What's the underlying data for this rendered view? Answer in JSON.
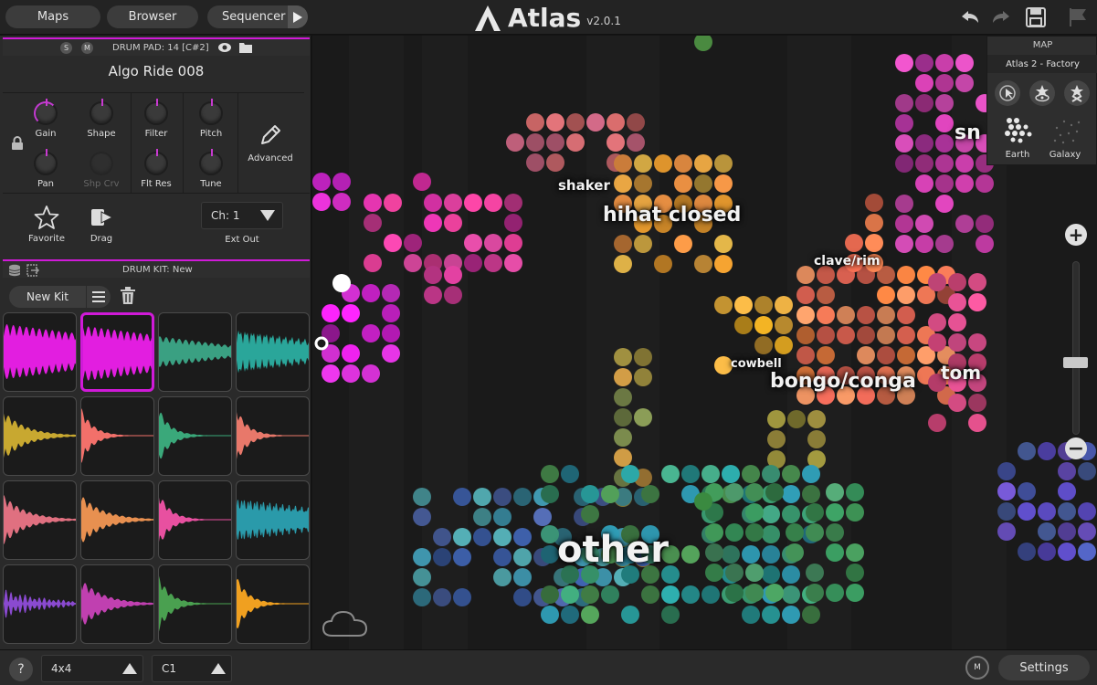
{
  "topbar": {
    "maps_label": "Maps",
    "browser_label": "Browser",
    "sequencer_label": "Sequencer",
    "app_name": "Atlas",
    "version": "v2.0.1"
  },
  "pad": {
    "solo": "S",
    "mute": "M",
    "title": "DRUM PAD: 14 [C#2]",
    "sample_name": "Algo Ride 008",
    "knobs": [
      {
        "label": "Gain",
        "value": 0.35
      },
      {
        "label": "Shape",
        "value": 0.5
      },
      {
        "label": "Filter",
        "value": 0.5
      },
      {
        "label": "Pitch",
        "value": 0.5
      },
      {
        "label": "Pan",
        "value": 0.5
      },
      {
        "label": "Shp Crv",
        "value": 0.5
      },
      {
        "label": "Flt Res",
        "value": 0.5
      },
      {
        "label": "Tune",
        "value": 0.5
      }
    ],
    "advanced_label": "Advanced",
    "favorite_label": "Favorite",
    "drag_label": "Drag",
    "channel": "Ch: 1",
    "ext_out_label": "Ext Out",
    "accent": "#d01ad8"
  },
  "kit": {
    "title": "DRUM KIT: New",
    "name_button": "New Kit",
    "pads": [
      {
        "color": "#e21ee0",
        "type": "sustain"
      },
      {
        "color": "#e21ee0",
        "type": "sustain",
        "selected": true
      },
      {
        "color": "#3aa082",
        "type": "fade"
      },
      {
        "color": "#2aa69a",
        "type": "comb"
      },
      {
        "color": "#c8a830",
        "type": "decay"
      },
      {
        "color": "#f2706a",
        "type": "hit"
      },
      {
        "color": "#3aa87a",
        "type": "hit"
      },
      {
        "color": "#e8786a",
        "type": "hit"
      },
      {
        "color": "#e07080",
        "type": "decay"
      },
      {
        "color": "#e89050",
        "type": "decay"
      },
      {
        "color": "#e850a0",
        "type": "hit"
      },
      {
        "color": "#2a9aaa",
        "type": "comb"
      },
      {
        "color": "#8a4ad0",
        "type": "wave"
      },
      {
        "color": "#c040b0",
        "type": "decay"
      },
      {
        "color": "#4aa050",
        "type": "hit"
      },
      {
        "color": "#f0a020",
        "type": "hit"
      }
    ]
  },
  "map": {
    "clusters": [
      {
        "label": "shaker",
        "size": 15
      },
      {
        "label": "hihat closed",
        "size": 22
      },
      {
        "label": "clave/rim",
        "size": 14
      },
      {
        "label": "cowbell",
        "size": 13
      },
      {
        "label": "bongo/conga",
        "size": 22
      },
      {
        "label": "tom",
        "size": 20
      },
      {
        "label": "sn",
        "size": 22
      },
      {
        "label": "other",
        "size": 40
      }
    ]
  },
  "map_panel": {
    "title": "MAP",
    "subtitle": "Atlas 2 - Factory",
    "earth_label": "Earth",
    "galaxy_label": "Galaxy"
  },
  "bottombar": {
    "help": "?",
    "grid_select": "4x4",
    "note_select": "C1",
    "midi": "M",
    "settings_label": "Settings"
  }
}
